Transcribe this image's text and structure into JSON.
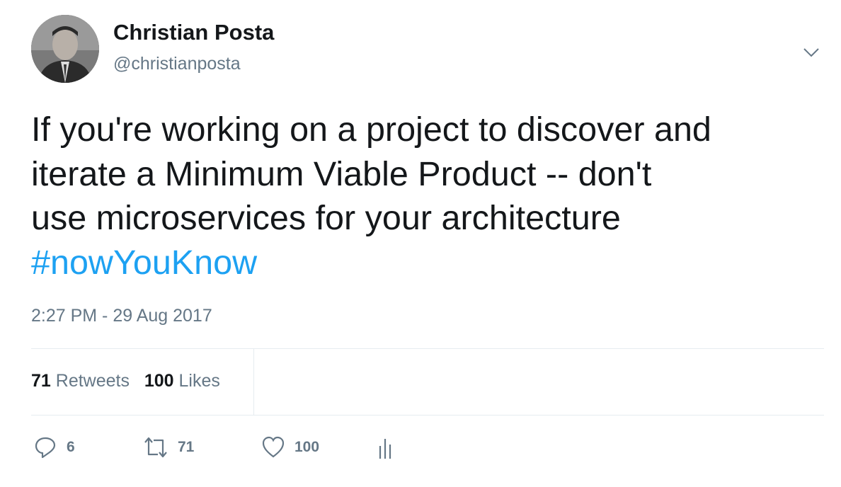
{
  "author": {
    "name": "Christian Posta",
    "handle": "@christianposta"
  },
  "tweet": {
    "lines": [
      "If you're working on a project to discover and",
      "iterate a Minimum Viable Product -- don't",
      "use microservices for your architecture"
    ],
    "hashtag": "#nowYouKnow",
    "timestamp": "2:27 PM - 29 Aug 2017"
  },
  "stats": {
    "retweets_count": "71",
    "retweets_label": "Retweets",
    "likes_count": "100",
    "likes_label": "Likes"
  },
  "actions": {
    "replies": "6",
    "retweets": "71",
    "likes": "100"
  },
  "colors": {
    "link": "#1da1f2",
    "muted": "#657786",
    "text": "#14171a"
  }
}
